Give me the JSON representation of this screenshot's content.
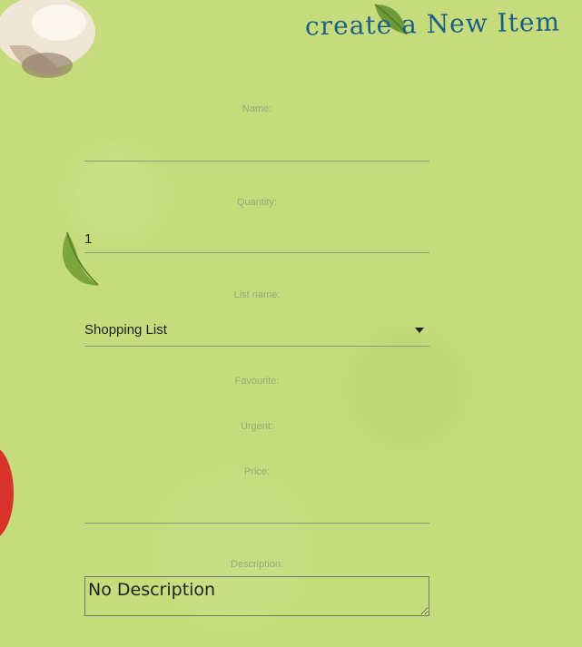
{
  "header": {
    "title": "create a New Item"
  },
  "form": {
    "name_label": "Name:",
    "name_value": "",
    "quantity_label": "Quantity:",
    "quantity_value": "1",
    "list_label": "List name:",
    "list_value": "Shopping List",
    "favourite_label": "Favourite:",
    "urgent_label": "Urgent:",
    "price_label": "Price:",
    "price_value": "",
    "description_label": "Description:",
    "description_value": "No Description"
  },
  "decorations": {
    "mushroom": "mushroom-image",
    "leaf_top": "leaf-image",
    "leaf_left": "leaf-image",
    "tomato": "tomato-image"
  }
}
